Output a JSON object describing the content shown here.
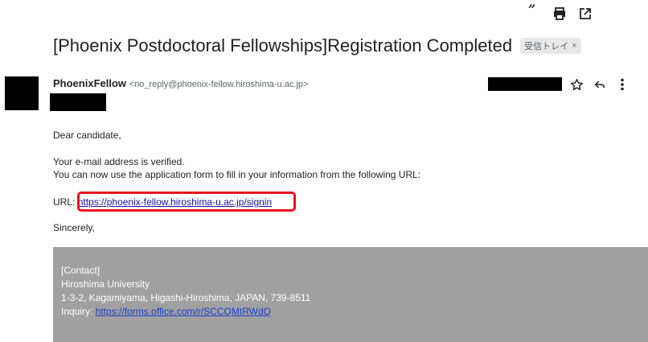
{
  "decor": {
    "quote_mark": "”"
  },
  "email": {
    "subject": "[Phoenix Postdoctoral Fellowships]Registration Completed",
    "label_chip": "受信トレイ",
    "label_chip_close": "×",
    "sender_name": "PhoenixFellow",
    "sender_email": "<no_reply@phoenix-fellow.hiroshima-u.ac.jp>",
    "greeting": "Dear candidate,",
    "body_line1": "Your e-mail address is verified.",
    "body_line2": "You can now use the application form to fill in your information from the following URL:",
    "url_label": "URL:",
    "url": "https://phoenix-fellow.hiroshima-u.ac.jp/signin",
    "signoff": "Sincerely,"
  },
  "footer": {
    "contact": "[Contact]",
    "org": "Hiroshima University",
    "address": "1-3-2, Kagamiyama, Higashi-Hiroshima, JAPAN, 739-8511",
    "inquiry_label": "Inquiry:",
    "inquiry_url": "https://forms.office.com/r/SCCQMtRWdQ"
  },
  "icons": {
    "print": "print-icon",
    "popout": "open-in-new-icon",
    "star": "star-icon",
    "reply": "reply-icon",
    "more": "more-vertical-icon"
  },
  "colors": {
    "link": "#1a0dab",
    "highlight": "#e8141e",
    "footer_bg": "#a0a0a0"
  }
}
